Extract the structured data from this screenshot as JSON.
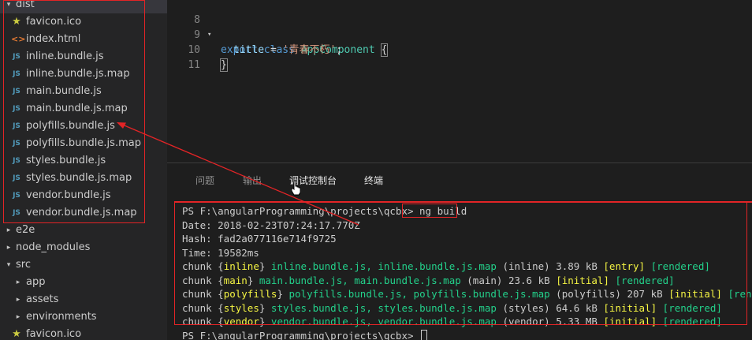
{
  "sidebar": {
    "dist_label": "dist",
    "dist_children": [
      {
        "label": "favicon.ico",
        "icon": "star-icon"
      },
      {
        "label": "index.html",
        "icon": "html-file-icon"
      },
      {
        "label": "inline.bundle.js",
        "icon": "js-file-icon"
      },
      {
        "label": "inline.bundle.js.map",
        "icon": "js-file-icon"
      },
      {
        "label": "main.bundle.js",
        "icon": "js-file-icon"
      },
      {
        "label": "main.bundle.js.map",
        "icon": "js-file-icon"
      },
      {
        "label": "polyfills.bundle.js",
        "icon": "js-file-icon"
      },
      {
        "label": "polyfills.bundle.js.map",
        "icon": "js-file-icon"
      },
      {
        "label": "styles.bundle.js",
        "icon": "js-file-icon"
      },
      {
        "label": "styles.bundle.js.map",
        "icon": "js-file-icon"
      },
      {
        "label": "vendor.bundle.js",
        "icon": "js-file-icon"
      },
      {
        "label": "vendor.bundle.js.map",
        "icon": "js-file-icon"
      }
    ],
    "e2e": "e2e",
    "node_modules": "node_modules",
    "src": "src",
    "src_children": [
      "app",
      "assets",
      "environments"
    ],
    "src_favicon": "favicon.ico",
    "js_badge": "JS",
    "html_badge": "<>",
    "star": "★"
  },
  "editor": {
    "line_numbers": [
      "8",
      "9",
      "10",
      "11"
    ],
    "line8_kw1": "export",
    "line8_kw2": "class",
    "line8_class": "AppComponent",
    "line8_brace": "{",
    "line9_prop": "title",
    "line9_eq": " = ",
    "line9_str": "'青春不朽'",
    "line9_semi": ";",
    "line10_brace": "}"
  },
  "panel": {
    "tabs": [
      "问题",
      "输出",
      "调试控制台",
      "终端"
    ],
    "active_tab": "终端"
  },
  "terminal": {
    "prompt": "PS F:\\angularProgramming\\projects\\qcbx>",
    "command": "ng build",
    "date": "Date: 2018-02-23T07:24:17.770Z",
    "hash": "Hash: fad2a077116e714f9725",
    "time": "Time: 19582ms",
    "chunks": [
      {
        "name": "inline",
        "files": "inline.bundle.js, inline.bundle.js.map",
        "tag": "(inline)",
        "size": "3.89 kB",
        "flag": "[entry]",
        "status": "[rendered]"
      },
      {
        "name": "main",
        "files": "main.bundle.js, main.bundle.js.map",
        "tag": "(main)",
        "size": "23.6 kB",
        "flag": "[initial]",
        "status": "[rendered]"
      },
      {
        "name": "polyfills",
        "files": "polyfills.bundle.js, polyfills.bundle.js.map",
        "tag": "(polyfills)",
        "size": "207 kB",
        "flag": "[initial]",
        "status": "[rendered]"
      },
      {
        "name": "styles",
        "files": "styles.bundle.js, styles.bundle.js.map",
        "tag": "(styles)",
        "size": "64.6 kB",
        "flag": "[initial]",
        "status": "[rendered]"
      },
      {
        "name": "vendor",
        "files": "vendor.bundle.js, vendor.bundle.js.map",
        "tag": "(vendor)",
        "size": "5.33 MB",
        "flag": "[initial]",
        "status": "[rendered]"
      }
    ],
    "chunk_word": "chunk",
    "last_prompt": "PS F:\\angularProgramming\\projects\\qcbx>"
  },
  "colors": {
    "annotation_red": "#e32426",
    "terminal_green": "#23d18b",
    "terminal_yellow": "#f5f543",
    "js_blue": "#519aba"
  }
}
